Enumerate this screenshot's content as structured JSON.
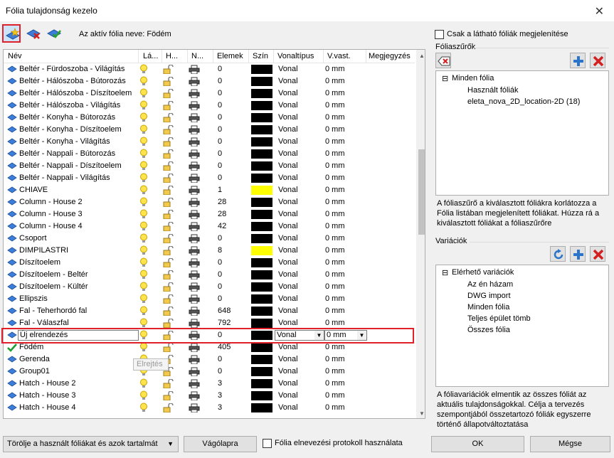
{
  "window": {
    "title": "Fólia tulajdonság kezelo",
    "close_glyph": "✕"
  },
  "toolbar": {
    "new_layer_icon": "new-layer-star-icon",
    "delete_layer_icon": "delete-layer-icon",
    "layer_check_icon": "layer-check-icon",
    "active_layer_label": "Az aktív fólia neve: Födém"
  },
  "table": {
    "columns": [
      "Név",
      "Lá...",
      "H...",
      "N...",
      "Elemek",
      "Szín",
      "Vonaltípus",
      "V.vast.",
      "Megjegyzés"
    ],
    "rows": [
      {
        "name": "Beltér - Fürdoszoba - Világítás",
        "elements": "0",
        "color": "#000000",
        "linetype": "Vonal",
        "width": "0 mm"
      },
      {
        "name": "Beltér - Hálószoba - Bútorozás",
        "elements": "0",
        "color": "#000000",
        "linetype": "Vonal",
        "width": "0 mm"
      },
      {
        "name": "Beltér - Hálószoba - Díszítoelem",
        "elements": "0",
        "color": "#000000",
        "linetype": "Vonal",
        "width": "0 mm"
      },
      {
        "name": "Beltér - Hálószoba - Világítás",
        "elements": "0",
        "color": "#000000",
        "linetype": "Vonal",
        "width": "0 mm"
      },
      {
        "name": "Beltér - Konyha - Bútorozás",
        "elements": "0",
        "color": "#000000",
        "linetype": "Vonal",
        "width": "0 mm"
      },
      {
        "name": "Beltér - Konyha - Díszítoelem",
        "elements": "0",
        "color": "#000000",
        "linetype": "Vonal",
        "width": "0 mm"
      },
      {
        "name": "Beltér - Konyha - Világítás",
        "elements": "0",
        "color": "#000000",
        "linetype": "Vonal",
        "width": "0 mm"
      },
      {
        "name": "Beltér - Nappali - Bútorozás",
        "elements": "0",
        "color": "#000000",
        "linetype": "Vonal",
        "width": "0 mm"
      },
      {
        "name": "Beltér - Nappali - Díszítoelem",
        "elements": "0",
        "color": "#000000",
        "linetype": "Vonal",
        "width": "0 mm"
      },
      {
        "name": "Beltér - Nappali - Világítás",
        "elements": "0",
        "color": "#000000",
        "linetype": "Vonal",
        "width": "0 mm"
      },
      {
        "name": "CHIAVE",
        "elements": "1",
        "color": "#ffff00",
        "linetype": "Vonal",
        "width": "0 mm"
      },
      {
        "name": "Column - House 2",
        "elements": "28",
        "color": "#000000",
        "linetype": "Vonal",
        "width": "0 mm"
      },
      {
        "name": "Column - House 3",
        "elements": "28",
        "color": "#000000",
        "linetype": "Vonal",
        "width": "0 mm"
      },
      {
        "name": "Column - House 4",
        "elements": "42",
        "color": "#000000",
        "linetype": "Vonal",
        "width": "0 mm"
      },
      {
        "name": "Csoport",
        "elements": "0",
        "color": "#000000",
        "linetype": "Vonal",
        "width": "0 mm"
      },
      {
        "name": "DIMPILASTRI",
        "elements": "8",
        "color": "#ffff00",
        "linetype": "Vonal",
        "width": "0 mm"
      },
      {
        "name": "Díszítoelem",
        "elements": "0",
        "color": "#000000",
        "linetype": "Vonal",
        "width": "0 mm"
      },
      {
        "name": "Díszítoelem - Beltér",
        "elements": "0",
        "color": "#000000",
        "linetype": "Vonal",
        "width": "0 mm"
      },
      {
        "name": "Díszítoelem - Kültér",
        "elements": "0",
        "color": "#000000",
        "linetype": "Vonal",
        "width": "0 mm"
      },
      {
        "name": "Ellipszis",
        "elements": "0",
        "color": "#000000",
        "linetype": "Vonal",
        "width": "0 mm"
      },
      {
        "name": "Fal - Teherhordó fal",
        "elements": "648",
        "color": "#000000",
        "linetype": "Vonal",
        "width": "0 mm"
      },
      {
        "name": "Fal - Válaszfal",
        "elements": "792",
        "color": "#000000",
        "linetype": "Vonal",
        "width": "0 mm"
      }
    ],
    "new_row": {
      "name": "Új elrendezés",
      "elements": "0",
      "color": "#000000",
      "linetype": "Vonal",
      "width": "0 mm"
    },
    "rows_after": [
      {
        "name": "Födém",
        "elements": "405",
        "color": "#000000",
        "linetype": "Vonal",
        "width": "0 mm",
        "active": true
      },
      {
        "name": "Gerenda",
        "elements": "0",
        "color": "#000000",
        "linetype": "Vonal",
        "width": "0 mm"
      },
      {
        "name": "Group01",
        "elements": "0",
        "color": "#000000",
        "linetype": "Vonal",
        "width": "0 mm"
      },
      {
        "name": "Hatch - House 2",
        "elements": "3",
        "color": "#000000",
        "linetype": "Vonal",
        "width": "0 mm"
      },
      {
        "name": "Hatch - House 3",
        "elements": "3",
        "color": "#000000",
        "linetype": "Vonal",
        "width": "0 mm"
      },
      {
        "name": "Hatch - House 4",
        "elements": "3",
        "color": "#000000",
        "linetype": "Vonal",
        "width": "0 mm"
      }
    ],
    "tooltip": "Elrejtés"
  },
  "right": {
    "visible_only_label": "Csak a látható fóliák megjelenítése",
    "filters": {
      "title": "Fóliaszűrők",
      "tree": {
        "root": "Minden fólia",
        "children": [
          "Használt fóliák",
          "eleta_nova_2D_location-2D (18)"
        ]
      },
      "description": "A fóliaszűrő a kiválasztott fóliákra korlátozza a Fólia listában megjelenített fóliákat. Húzza rá a kiválasztott fóliákat a fóliaszűrőre"
    },
    "variations": {
      "title": "Variációk",
      "tree": {
        "root": "Elérhető variációk",
        "children": [
          "Az én házam",
          "DWG import",
          "Minden fólia",
          "Teljes épület tömb",
          "Összes fólia"
        ]
      },
      "description": "A fóliavariációk elmentik az összes fóliát az aktuális tulajdonságokkal. Célja a tervezés szempontjából összetartozó fóliák egyszerre történő állapotváltoztatása"
    }
  },
  "bottom": {
    "delete_combo": "Törölje a használt fóliákat és azok tartalmát",
    "clipboard_button": "Vágólapra",
    "protocol_label": "Fólia elnevezési protokoll használata",
    "ok_button": "OK",
    "cancel_button": "Mégse"
  }
}
